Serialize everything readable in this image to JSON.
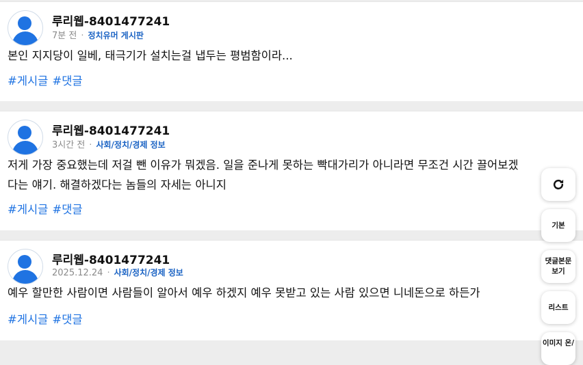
{
  "posts": [
    {
      "author": "루리웹-8401477241",
      "time": "7분 전",
      "board": "정치유머 게시판",
      "text": "본인 지지당이 일베, 태극기가 설치는걸 냅두는 평범함이라...",
      "text2": "",
      "tags": [
        "#게시글",
        "#댓글"
      ]
    },
    {
      "author": "루리웹-8401477241",
      "time": "3시간 전",
      "board": "사회/정치/경제 정보",
      "text": "저게 가장 중요했는데 저걸 뺀 이유가 뭐겠음. 일을 준나게 못하는 빡대가리가 아니라면 무조건 시간 끌어보겠",
      "text2": "다는 얘기. 해결하겠다는 놈들의 자세는 아니지",
      "tags": [
        "#게시글",
        "#댓글"
      ]
    },
    {
      "author": "루리웹-8401477241",
      "time": "2025.12.24",
      "board": "사회/정치/경제 정보",
      "text": "예우 할만한 사람이면 사람들이 알아서 예우 하겠지 예우 못받고 있는 사람 있으면 니네돈으로 하든가",
      "text2": "",
      "tags": [
        "#게시글",
        "#댓글"
      ]
    }
  ],
  "side_buttons": {
    "refresh_icon": "refresh-icon",
    "basic": "기본",
    "comment_body": "댓글본문\n보기",
    "comment_body_line1": "댓글본문",
    "comment_body_line2": "보기",
    "list": "리스트",
    "image_on": "이미지 온/"
  },
  "colors": {
    "accent": "#1f73e2",
    "board_link": "#1c64c4",
    "page_bg": "#ededed"
  }
}
